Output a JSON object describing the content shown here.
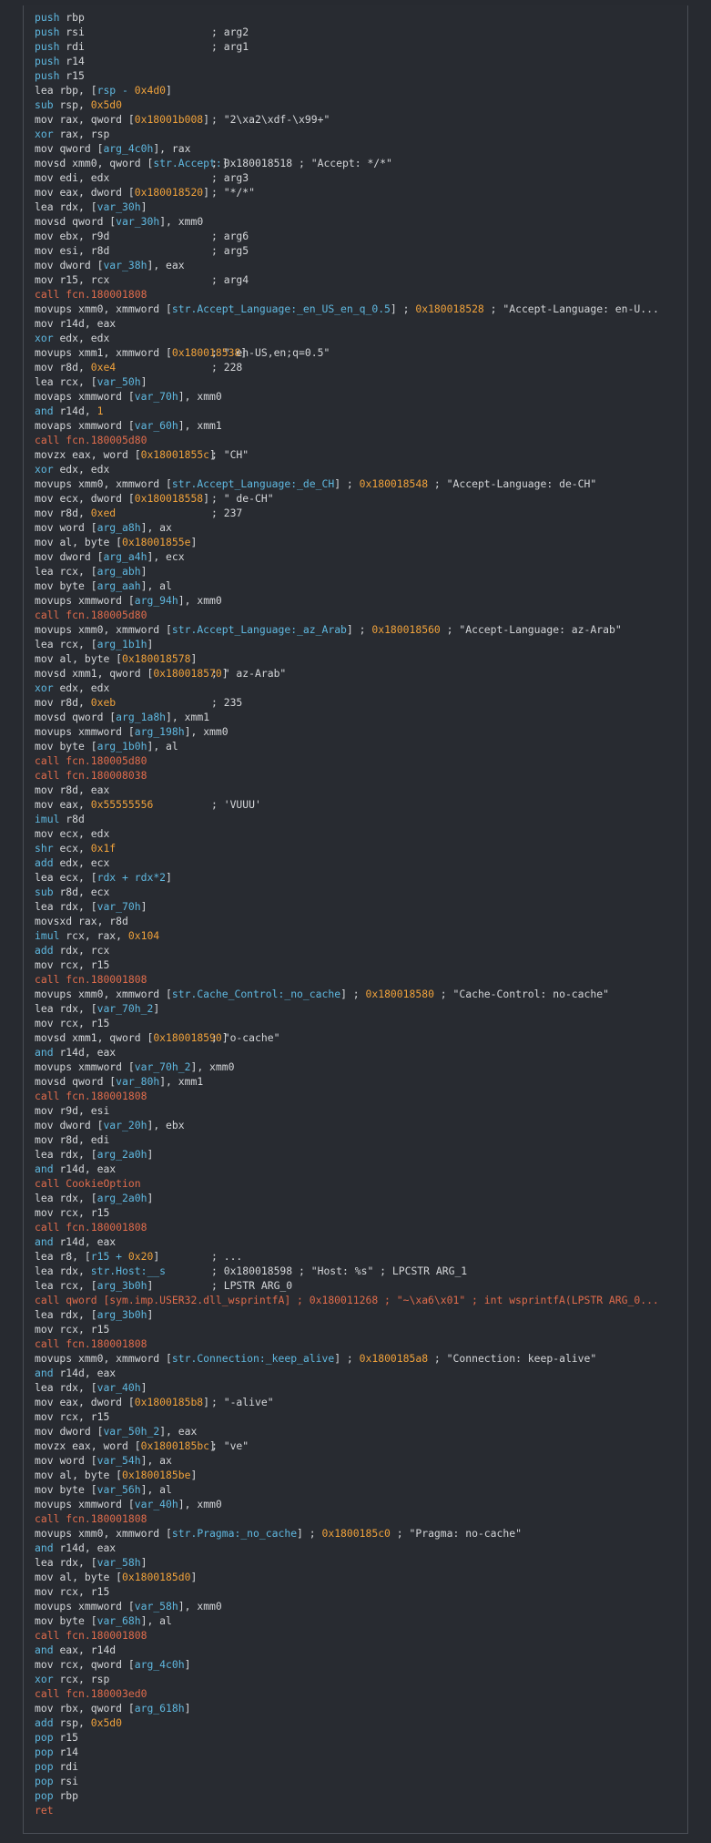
{
  "colors": {
    "background": "#272a30",
    "text": "#d7d9dc",
    "call": "#e06c4c",
    "control": "#5fb8e0",
    "number": "#f0a23b",
    "symbol": "#5fb8e0"
  },
  "lines": [
    {
      "mn": "push",
      "op": "rbp",
      "cls": "ctrl"
    },
    {
      "mn": "push",
      "op": "rsi",
      "cls": "ctrl",
      "cm": "; arg2"
    },
    {
      "mn": "push",
      "op": "rdi",
      "cls": "ctrl",
      "cm": "; arg1"
    },
    {
      "mn": "push",
      "op": "r14",
      "cls": "ctrl"
    },
    {
      "mn": "push",
      "op": "r15",
      "cls": "ctrl"
    },
    {
      "mn": "lea",
      "op": "rbp, [rsp - 0x4d0]"
    },
    {
      "mn": "sub",
      "op": "rsp, 0x5d0",
      "cls": "ctrl"
    },
    {
      "mn": "mov",
      "op": "rax, qword [0x18001b008]",
      "cm": "; \"2\\xa2\\xdf-\\x99+\""
    },
    {
      "mn": "xor",
      "op": "rax, rsp",
      "cls": "ctrl"
    },
    {
      "mn": "mov",
      "op": "qword [arg_4c0h], rax"
    },
    {
      "mn": "movsd",
      "op": "xmm0, qword [str.Accept:]",
      "cm": "; 0x180018518 ; \"Accept: */*\""
    },
    {
      "mn": "mov",
      "op": "edi, edx",
      "cm": "; arg3"
    },
    {
      "mn": "mov",
      "op": "eax, dword [0x180018520]",
      "cm": "; \"*/*\""
    },
    {
      "mn": "lea",
      "op": "rdx, [var_30h]"
    },
    {
      "mn": "movsd",
      "op": "qword [var_30h], xmm0"
    },
    {
      "mn": "mov",
      "op": "ebx, r9d",
      "cm": "; arg6"
    },
    {
      "mn": "mov",
      "op": "esi, r8d",
      "cm": "; arg5"
    },
    {
      "mn": "mov",
      "op": "dword [var_38h], eax"
    },
    {
      "mn": "mov",
      "op": "r15, rcx",
      "cm": "; arg4"
    },
    {
      "mn": "call",
      "op": "fcn.180001808",
      "cls": "call"
    },
    {
      "mn": "movups",
      "op": "xmm0, xmmword [str.Accept_Language:_en_US_en_q_0.5] ; 0x180018528 ; \"Accept-Language: en-U..."
    },
    {
      "mn": "mov",
      "op": "r14d, eax"
    },
    {
      "mn": "xor",
      "op": "edx, edx",
      "cls": "ctrl"
    },
    {
      "mn": "movups",
      "op": "xmm1, xmmword [0x180018538]",
      "cm": "; \" en-US,en;q=0.5\""
    },
    {
      "mn": "mov",
      "op": "r8d, 0xe4",
      "cm": "; 228"
    },
    {
      "mn": "lea",
      "op": "rcx, [var_50h]"
    },
    {
      "mn": "movaps",
      "op": "xmmword [var_70h], xmm0"
    },
    {
      "mn": "and",
      "op": "r14d, 1",
      "cls": "ctrl"
    },
    {
      "mn": "movaps",
      "op": "xmmword [var_60h], xmm1"
    },
    {
      "mn": "call",
      "op": "fcn.180005d80",
      "cls": "call"
    },
    {
      "mn": "movzx",
      "op": "eax, word [0x18001855c]",
      "cm": "; \"CH\""
    },
    {
      "mn": "xor",
      "op": "edx, edx",
      "cls": "ctrl"
    },
    {
      "mn": "movups",
      "op": "xmm0, xmmword [str.Accept_Language:_de_CH] ; 0x180018548 ; \"Accept-Language: de-CH\""
    },
    {
      "mn": "mov",
      "op": "ecx, dword [0x180018558]",
      "cm": "; \" de-CH\""
    },
    {
      "mn": "mov",
      "op": "r8d, 0xed",
      "cm": "; 237"
    },
    {
      "mn": "mov",
      "op": "word [arg_a8h], ax"
    },
    {
      "mn": "mov",
      "op": "al, byte [0x18001855e]"
    },
    {
      "mn": "mov",
      "op": "dword [arg_a4h], ecx"
    },
    {
      "mn": "lea",
      "op": "rcx, [arg_abh]"
    },
    {
      "mn": "mov",
      "op": "byte [arg_aah], al"
    },
    {
      "mn": "movups",
      "op": "xmmword [arg_94h], xmm0"
    },
    {
      "mn": "call",
      "op": "fcn.180005d80",
      "cls": "call"
    },
    {
      "mn": "movups",
      "op": "xmm0, xmmword [str.Accept_Language:_az_Arab] ; 0x180018560 ; \"Accept-Language: az-Arab\""
    },
    {
      "mn": "lea",
      "op": "rcx, [arg_1b1h]"
    },
    {
      "mn": "mov",
      "op": "al, byte [0x180018578]"
    },
    {
      "mn": "movsd",
      "op": "xmm1, qword [0x180018570]",
      "cm": "; \" az-Arab\""
    },
    {
      "mn": "xor",
      "op": "edx, edx",
      "cls": "ctrl"
    },
    {
      "mn": "mov",
      "op": "r8d, 0xeb",
      "cm": "; 235"
    },
    {
      "mn": "movsd",
      "op": "qword [arg_1a8h], xmm1"
    },
    {
      "mn": "movups",
      "op": "xmmword [arg_198h], xmm0"
    },
    {
      "mn": "mov",
      "op": "byte [arg_1b0h], al"
    },
    {
      "mn": "call",
      "op": "fcn.180005d80",
      "cls": "call"
    },
    {
      "mn": "call",
      "op": "fcn.180008038",
      "cls": "call"
    },
    {
      "mn": "mov",
      "op": "r8d, eax"
    },
    {
      "mn": "mov",
      "op": "eax, 0x55555556",
      "cm": "; 'VUUU'"
    },
    {
      "mn": "imul",
      "op": "r8d",
      "cls": "ctrl"
    },
    {
      "mn": "mov",
      "op": "ecx, edx"
    },
    {
      "mn": "shr",
      "op": "ecx, 0x1f",
      "cls": "ctrl"
    },
    {
      "mn": "add",
      "op": "edx, ecx",
      "cls": "ctrl"
    },
    {
      "mn": "lea",
      "op": "ecx, [rdx + rdx*2]"
    },
    {
      "mn": "sub",
      "op": "r8d, ecx",
      "cls": "ctrl"
    },
    {
      "mn": "lea",
      "op": "rdx, [var_70h]"
    },
    {
      "mn": "movsxd",
      "op": "rax, r8d"
    },
    {
      "mn": "imul",
      "op": "rcx, rax, 0x104",
      "cls": "ctrl"
    },
    {
      "mn": "add",
      "op": "rdx, rcx",
      "cls": "ctrl"
    },
    {
      "mn": "mov",
      "op": "rcx, r15"
    },
    {
      "mn": "call",
      "op": "fcn.180001808",
      "cls": "call"
    },
    {
      "mn": "movups",
      "op": "xmm0, xmmword [str.Cache_Control:_no_cache] ; 0x180018580 ; \"Cache-Control: no-cache\""
    },
    {
      "mn": "lea",
      "op": "rdx, [var_70h_2]"
    },
    {
      "mn": "mov",
      "op": "rcx, r15"
    },
    {
      "mn": "movsd",
      "op": "xmm1, qword [0x180018590]",
      "cm": "; \"o-cache\""
    },
    {
      "mn": "and",
      "op": "r14d, eax",
      "cls": "ctrl"
    },
    {
      "mn": "movups",
      "op": "xmmword [var_70h_2], xmm0"
    },
    {
      "mn": "movsd",
      "op": "qword [var_80h], xmm1"
    },
    {
      "mn": "call",
      "op": "fcn.180001808",
      "cls": "call"
    },
    {
      "mn": "mov",
      "op": "r9d, esi"
    },
    {
      "mn": "mov",
      "op": "dword [var_20h], ebx"
    },
    {
      "mn": "mov",
      "op": "r8d, edi"
    },
    {
      "mn": "lea",
      "op": "rdx, [arg_2a0h]"
    },
    {
      "mn": "and",
      "op": "r14d, eax",
      "cls": "ctrl"
    },
    {
      "mn": "call",
      "op": "CookieOption",
      "cls": "call"
    },
    {
      "mn": "lea",
      "op": "rdx, [arg_2a0h]"
    },
    {
      "mn": "mov",
      "op": "rcx, r15"
    },
    {
      "mn": "call",
      "op": "fcn.180001808",
      "cls": "call"
    },
    {
      "mn": "and",
      "op": "r14d, eax",
      "cls": "ctrl"
    },
    {
      "mn": "lea",
      "op": "r8, [r15 + 0x20]",
      "cm": "; ..."
    },
    {
      "mn": "lea",
      "op": "rdx, str.Host:__s",
      "cm": "; 0x180018598 ; \"Host: %s\" ; LPCSTR ARG_1"
    },
    {
      "mn": "lea",
      "op": "rcx, [arg_3b0h]",
      "cm": "; LPSTR ARG_0"
    },
    {
      "mn": "call",
      "op": "qword [sym.imp.USER32.dll_wsprintfA] ; 0x180011268 ; \"~\\xa6\\x01\" ; int wsprintfA(LPSTR ARG_0...",
      "cls": "call"
    },
    {
      "mn": "lea",
      "op": "rdx, [arg_3b0h]"
    },
    {
      "mn": "mov",
      "op": "rcx, r15"
    },
    {
      "mn": "call",
      "op": "fcn.180001808",
      "cls": "call"
    },
    {
      "mn": "movups",
      "op": "xmm0, xmmword [str.Connection:_keep_alive] ; 0x1800185a8 ; \"Connection: keep-alive\""
    },
    {
      "mn": "and",
      "op": "r14d, eax",
      "cls": "ctrl"
    },
    {
      "mn": "lea",
      "op": "rdx, [var_40h]"
    },
    {
      "mn": "mov",
      "op": "eax, dword [0x1800185b8]",
      "cm": "; \"-alive\""
    },
    {
      "mn": "mov",
      "op": "rcx, r15"
    },
    {
      "mn": "mov",
      "op": "dword [var_50h_2], eax"
    },
    {
      "mn": "movzx",
      "op": "eax, word [0x1800185bc]",
      "cm": "; \"ve\""
    },
    {
      "mn": "mov",
      "op": "word [var_54h], ax"
    },
    {
      "mn": "mov",
      "op": "al, byte [0x1800185be]"
    },
    {
      "mn": "mov",
      "op": "byte [var_56h], al"
    },
    {
      "mn": "movups",
      "op": "xmmword [var_40h], xmm0"
    },
    {
      "mn": "call",
      "op": "fcn.180001808",
      "cls": "call"
    },
    {
      "mn": "movups",
      "op": "xmm0, xmmword [str.Pragma:_no_cache] ; 0x1800185c0 ; \"Pragma: no-cache\""
    },
    {
      "mn": "and",
      "op": "r14d, eax",
      "cls": "ctrl"
    },
    {
      "mn": "lea",
      "op": "rdx, [var_58h]"
    },
    {
      "mn": "mov",
      "op": "al, byte [0x1800185d0]"
    },
    {
      "mn": "mov",
      "op": "rcx, r15"
    },
    {
      "mn": "movups",
      "op": "xmmword [var_58h], xmm0"
    },
    {
      "mn": "mov",
      "op": "byte [var_68h], al"
    },
    {
      "mn": "call",
      "op": "fcn.180001808",
      "cls": "call"
    },
    {
      "mn": "and",
      "op": "eax, r14d",
      "cls": "ctrl"
    },
    {
      "mn": "mov",
      "op": "rcx, qword [arg_4c0h]"
    },
    {
      "mn": "xor",
      "op": "rcx, rsp",
      "cls": "ctrl"
    },
    {
      "mn": "call",
      "op": "fcn.180003ed0",
      "cls": "call"
    },
    {
      "mn": "mov",
      "op": "rbx, qword [arg_618h]"
    },
    {
      "mn": "add",
      "op": "rsp, 0x5d0",
      "cls": "ctrl"
    },
    {
      "mn": "pop",
      "op": "r15",
      "cls": "ctrl"
    },
    {
      "mn": "pop",
      "op": "r14",
      "cls": "ctrl"
    },
    {
      "mn": "pop",
      "op": "rdi",
      "cls": "ctrl"
    },
    {
      "mn": "pop",
      "op": "rsi",
      "cls": "ctrl"
    },
    {
      "mn": "pop",
      "op": "rbp",
      "cls": "ctrl"
    },
    {
      "mn": "ret",
      "op": "",
      "cls": "call"
    }
  ]
}
